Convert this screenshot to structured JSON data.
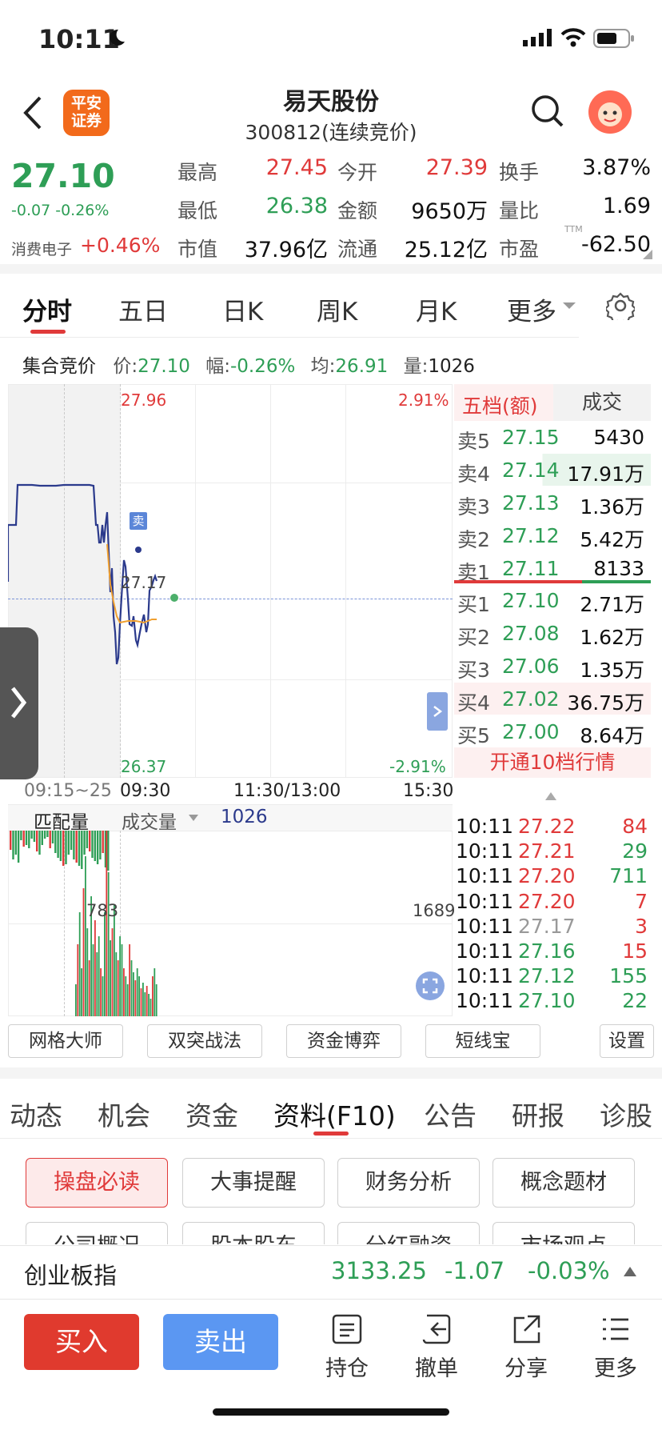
{
  "status": {
    "time": "10:11"
  },
  "header": {
    "title": "易天股份",
    "subtitle": "300812(连续竞价)",
    "logo_text": "平安\n证券"
  },
  "quote": {
    "price": "27.10",
    "change": "-0.07",
    "change_pct": "-0.26%",
    "sector_name": "消费电子",
    "sector_pct": "+0.46%",
    "fields": [
      {
        "label": "最高",
        "value": "27.45",
        "color": "red"
      },
      {
        "label": "今开",
        "value": "27.39",
        "color": "red"
      },
      {
        "label": "换手",
        "value": "3.87%",
        "color": "black"
      },
      {
        "label": "最低",
        "value": "26.38",
        "color": "green"
      },
      {
        "label": "金额",
        "value": "9650万",
        "color": "black"
      },
      {
        "label": "量比",
        "value": "1.69",
        "color": "black"
      },
      {
        "label": "市值",
        "value": "37.96亿",
        "color": "black"
      },
      {
        "label": "流通",
        "value": "25.12亿",
        "color": "black"
      },
      {
        "label": "市盈",
        "value": "-62.50",
        "color": "black",
        "sup": "TTM"
      }
    ]
  },
  "tabs": [
    "分时",
    "五日",
    "日K",
    "周K",
    "月K",
    "更多"
  ],
  "info_bar": {
    "label": "集合竞价",
    "price_label": "价:",
    "price": "27.10",
    "amp_label": "幅:",
    "amp": "-0.26%",
    "avg_label": "均:",
    "avg": "26.91",
    "vol_label": "量:",
    "vol": "1026"
  },
  "chart": {
    "high": "27.96",
    "low": "26.37",
    "high_pct": "2.91%",
    "low_pct": "-2.91%",
    "current_label": "27.17",
    "sell_marker": "卖",
    "time_labels": [
      "09:15~25",
      "09:30",
      "11:30/13:00",
      "15:30"
    ],
    "vol_header": {
      "label1": "匹配量",
      "label2": "成交量",
      "value": "1026"
    },
    "vol_left_max": "783",
    "vol_right_max": "1689",
    "colors": {
      "up": "#e03a3a",
      "down": "#2e9e56",
      "price_line": "#2b3a8c",
      "avg_line": "#f0a030"
    }
  },
  "order_book": {
    "header_left": "五档(额)",
    "header_right": "成交",
    "sells": [
      {
        "label": "卖5",
        "price": "27.15",
        "vol": "5430"
      },
      {
        "label": "卖4",
        "price": "27.14",
        "vol": "17.91万"
      },
      {
        "label": "卖3",
        "price": "27.13",
        "vol": "1.36万"
      },
      {
        "label": "卖2",
        "price": "27.12",
        "vol": "5.42万"
      },
      {
        "label": "卖1",
        "price": "27.11",
        "vol": "8133"
      }
    ],
    "buys": [
      {
        "label": "买1",
        "price": "27.10",
        "vol": "2.71万"
      },
      {
        "label": "买2",
        "price": "27.08",
        "vol": "1.62万"
      },
      {
        "label": "买3",
        "price": "27.06",
        "vol": "1.35万"
      },
      {
        "label": "买4",
        "price": "27.02",
        "vol": "36.75万"
      },
      {
        "label": "买5",
        "price": "27.00",
        "vol": "8.64万"
      }
    ],
    "upgrade": "开通10档行情"
  },
  "trades": [
    {
      "time": "10:11",
      "price": "27.22",
      "vol": "84",
      "pc": "red",
      "vc": "red"
    },
    {
      "time": "10:11",
      "price": "27.21",
      "vol": "29",
      "pc": "red",
      "vc": "green"
    },
    {
      "time": "10:11",
      "price": "27.20",
      "vol": "711",
      "pc": "red",
      "vc": "green"
    },
    {
      "time": "10:11",
      "price": "27.20",
      "vol": "7",
      "pc": "red",
      "vc": "red"
    },
    {
      "time": "10:11",
      "price": "27.17",
      "vol": "3",
      "pc": "gray",
      "vc": "red"
    },
    {
      "time": "10:11",
      "price": "27.16",
      "vol": "15",
      "pc": "green",
      "vc": "red"
    },
    {
      "time": "10:11",
      "price": "27.12",
      "vol": "155",
      "pc": "green",
      "vc": "green"
    },
    {
      "time": "10:11",
      "price": "27.10",
      "vol": "22",
      "pc": "green",
      "vc": "green"
    }
  ],
  "tools": [
    "网格大师",
    "双突战法",
    "资金博弈",
    "短线宝",
    "设置"
  ],
  "f10_tabs": [
    "动态",
    "机会",
    "资金",
    "资料(F10)",
    "公告",
    "研报",
    "诊股"
  ],
  "f10_buttons": [
    "操盘必读",
    "大事提醒",
    "财务分析",
    "概念题材",
    "公司概况",
    "股本股东",
    "分红融资",
    "市场观点"
  ],
  "index_bar": {
    "name": "创业板指",
    "value": "3133.25",
    "change": "-1.07",
    "pct": "-0.03%"
  },
  "bottom": {
    "buy": "买入",
    "sell": "卖出",
    "items": [
      "持仓",
      "撤单",
      "分享",
      "更多"
    ]
  }
}
